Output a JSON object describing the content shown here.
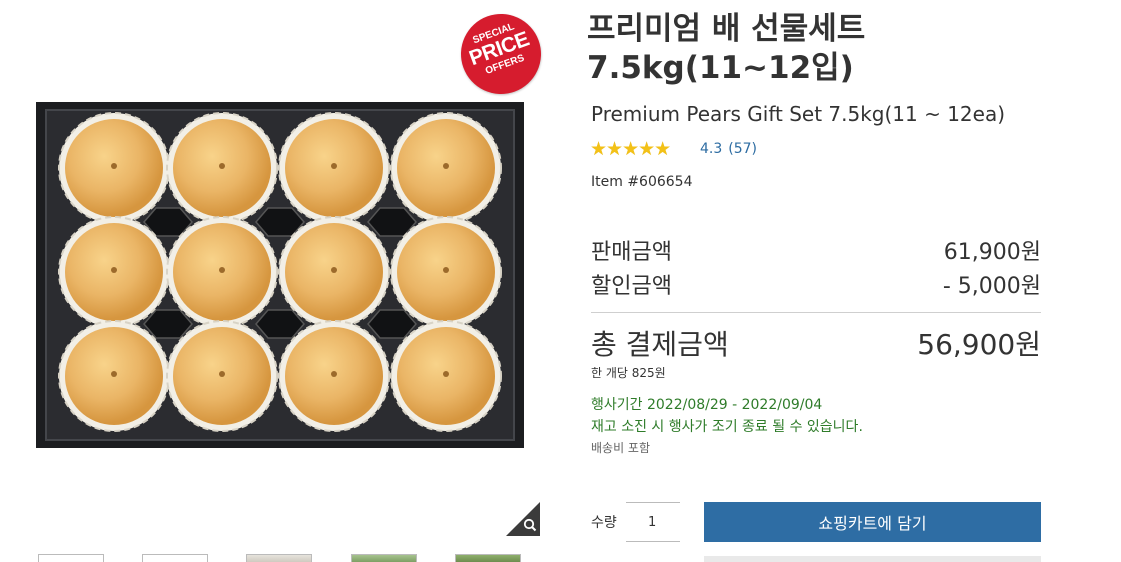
{
  "badge": {
    "line1": "SPECIAL",
    "line2": "PRICE",
    "line3": "OFFERS"
  },
  "product": {
    "title_ko": "프리미엄 배 선물세트\n7.5kg(11~12입)",
    "title_en": "Premium Pears Gift Set 7.5kg(11 ~ 12ea)",
    "rating": {
      "score": "4.3",
      "count": "(57)",
      "stars_value": 4.3,
      "stars_max": 5
    },
    "item_number": "Item #606654"
  },
  "pricing": {
    "sale_label": "판매금액",
    "sale_value": "61,900원",
    "discount_label": "할인금액",
    "discount_value": "- 5,000원",
    "total_label": "총 결제금액",
    "total_value": "56,900원",
    "per_unit": "한 개당 825원",
    "period": "행사기간 2022/08/29 - 2022/09/04",
    "notice": "재고 소진 시 행사가 조기 종료 될 수 있습니다.",
    "shipping": "배송비 포함"
  },
  "purchase": {
    "qty_label": "수량",
    "qty_value": "1",
    "cart_button": "쇼핑카트에 담기"
  },
  "icons": {
    "zoom": "magnifier-icon",
    "star": "star-icon"
  },
  "colors": {
    "accent": "#2e6da4",
    "badge": "#d61c2e",
    "promo_text": "#2f7c2a",
    "star": "#f3c117"
  }
}
